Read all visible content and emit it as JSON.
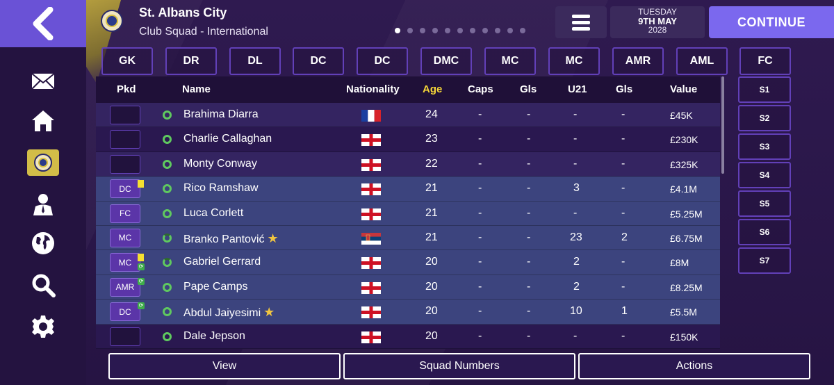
{
  "header": {
    "club_name": "St. Albans City",
    "subtitle": "Club Squad - International",
    "date_line1": "TUESDAY",
    "date_line2": "9TH MAY",
    "date_line3": "2028",
    "continue_label": "CONTINUE",
    "page_dots": 11,
    "active_dot": 0
  },
  "positions": [
    "GK",
    "DR",
    "DL",
    "DC",
    "DC",
    "DMC",
    "MC",
    "MC",
    "AMR",
    "AML",
    "FC"
  ],
  "subs": [
    "S1",
    "S2",
    "S3",
    "S4",
    "S5",
    "S6",
    "S7"
  ],
  "columns": {
    "pkd": "Pkd",
    "name": "Name",
    "nationality": "Nationality",
    "age": "Age",
    "caps": "Caps",
    "gls": "Gls",
    "u21": "U21",
    "gls2": "Gls",
    "value": "Value"
  },
  "rows": [
    {
      "pkd": "",
      "name": "Brahima Diarra",
      "flag": "france",
      "age": "24",
      "caps": "-",
      "gls": "-",
      "u21": "-",
      "gls2": "-",
      "value": "£45K",
      "star": false
    },
    {
      "pkd": "",
      "name": "Charlie Callaghan",
      "flag": "england",
      "age": "23",
      "caps": "-",
      "gls": "-",
      "u21": "-",
      "gls2": "-",
      "value": "£230K",
      "star": false
    },
    {
      "pkd": "",
      "name": "Monty Conway",
      "flag": "england",
      "age": "22",
      "caps": "-",
      "gls": "-",
      "u21": "-",
      "gls2": "-",
      "value": "£325K",
      "star": false
    },
    {
      "pkd": "DC",
      "name": "Rico Ramshaw",
      "flag": "england",
      "age": "21",
      "caps": "-",
      "gls": "-",
      "u21": "3",
      "gls2": "-",
      "value": "£4.1M",
      "star": false
    },
    {
      "pkd": "FC",
      "name": "Luca Corlett",
      "flag": "england",
      "age": "21",
      "caps": "-",
      "gls": "-",
      "u21": "-",
      "gls2": "-",
      "value": "£5.25M",
      "star": false
    },
    {
      "pkd": "MC",
      "name": "Branko Pantović",
      "flag": "serbia",
      "age": "21",
      "caps": "-",
      "gls": "-",
      "u21": "23",
      "gls2": "2",
      "value": "£6.75M",
      "star": true
    },
    {
      "pkd": "MC",
      "name": "Gabriel Gerrard",
      "flag": "england",
      "age": "20",
      "caps": "-",
      "gls": "-",
      "u21": "2",
      "gls2": "-",
      "value": "£8M",
      "star": false
    },
    {
      "pkd": "AMR",
      "name": "Pape Camps",
      "flag": "england",
      "age": "20",
      "caps": "-",
      "gls": "-",
      "u21": "2",
      "gls2": "-",
      "value": "£8.25M",
      "star": false
    },
    {
      "pkd": "DC",
      "name": "Abdul Jaiyesimi",
      "flag": "england",
      "age": "20",
      "caps": "-",
      "gls": "-",
      "u21": "10",
      "gls2": "1",
      "value": "£5.5M",
      "star": true
    },
    {
      "pkd": "",
      "name": "Dale Jepson",
      "flag": "england",
      "age": "20",
      "caps": "-",
      "gls": "-",
      "u21": "-",
      "gls2": "-",
      "value": "£150K",
      "star": false
    }
  ],
  "bottom": {
    "view": "View",
    "squad_numbers": "Squad Numbers",
    "actions": "Actions"
  },
  "colors": {
    "accent": "#7b68ee",
    "age_header": "#f5d638",
    "status_green": "#5fc95f"
  }
}
